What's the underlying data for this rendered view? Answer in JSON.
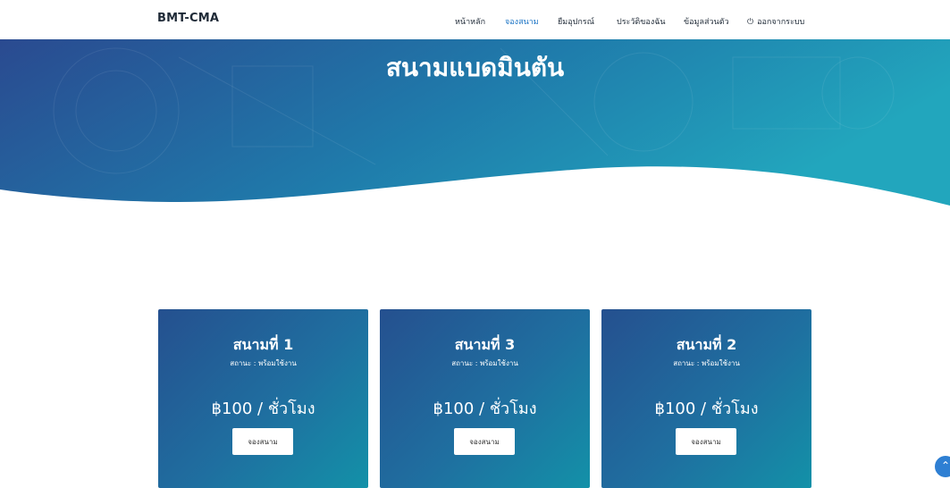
{
  "brand": "BMT-CMA",
  "nav": {
    "items": [
      {
        "label": "หน้าหลัก",
        "active": false
      },
      {
        "label": "จองสนาม",
        "active": true
      },
      {
        "label": "ยืมอุปกรณ์",
        "active": false
      },
      {
        "label": "ประวัติของฉัน",
        "active": false
      },
      {
        "label": "ข้อมูลส่วนตัว",
        "active": false
      },
      {
        "label": "ออกจากระบบ",
        "active": false,
        "icon": "power-icon"
      }
    ],
    "active_color": "#1a73c4"
  },
  "hero": {
    "title": "สนามแบดมินตัน",
    "gradient": [
      "#2a4a90",
      "#1f7bab",
      "#22a6bd"
    ]
  },
  "courts": [
    {
      "name": "สนามที่ 1",
      "status": "สถานะ : พร้อมใช้งาน",
      "price": "฿100 / ชั่วโมง",
      "button": "จองสนาม"
    },
    {
      "name": "สนามที่ 3",
      "status": "สถานะ : พร้อมใช้งาน",
      "price": "฿100 / ชั่วโมง",
      "button": "จองสนาม"
    },
    {
      "name": "สนามที่ 2",
      "status": "สถานะ : พร้อมใช้งาน",
      "price": "฿100 / ชั่วโมง",
      "button": "จองสนาม"
    }
  ],
  "scroll_top": {
    "icon": "chevron-up-icon"
  }
}
